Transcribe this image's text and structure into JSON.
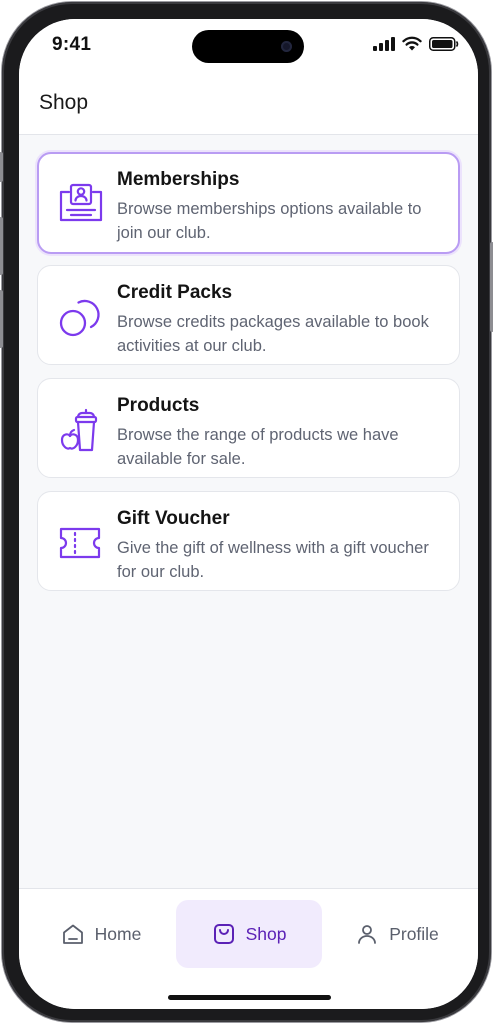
{
  "status_bar": {
    "time": "9:41"
  },
  "header": {
    "title": "Shop"
  },
  "cards": [
    {
      "title": "Memberships",
      "description": "Browse memberships options available to join our club.",
      "icon": "membership-card-icon",
      "selected": true
    },
    {
      "title": "Credit Packs",
      "description": "Browse credits packages available to book activities at our club.",
      "icon": "coins-icon",
      "selected": false
    },
    {
      "title": "Products",
      "description": "Browse the range of products we have available for sale.",
      "icon": "products-icon",
      "selected": false
    },
    {
      "title": "Gift Voucher",
      "description": "Give the gift of wellness with a gift voucher for our club.",
      "icon": "ticket-icon",
      "selected": false
    }
  ],
  "bottom_nav": {
    "items": [
      {
        "label": "Home",
        "icon": "home-icon",
        "active": false
      },
      {
        "label": "Shop",
        "icon": "shopping-bag-icon",
        "active": true
      },
      {
        "label": "Profile",
        "icon": "user-icon",
        "active": false
      }
    ]
  },
  "colors": {
    "accent": "#7c3aed",
    "accent_dark": "#5b21b6",
    "accent_light": "#f1ebfd",
    "selected_border": "#b99cf3"
  }
}
